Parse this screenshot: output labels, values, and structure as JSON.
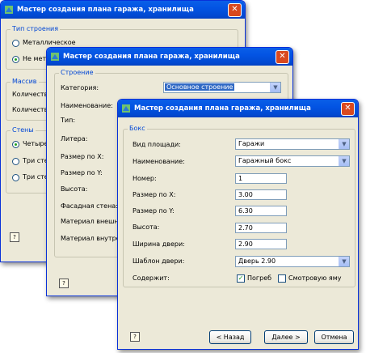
{
  "windows": {
    "w1": {
      "title": "Мастер создания плана гаража, хранилища",
      "close_glyph": "✕",
      "group_type": {
        "label": "Тип строения",
        "options": [
          "Металлическое",
          "Не мет"
        ]
      },
      "group_massiv": {
        "label": "Массив",
        "rows": [
          "Количеств",
          "Количеств"
        ]
      },
      "group_walls": {
        "label": "Стены",
        "options": [
          "Четыре",
          "Три сте",
          "Три сте"
        ]
      },
      "help_glyph": "?"
    },
    "w2": {
      "title": "Мастер создания плана гаража, хранилища",
      "close_glyph": "✕",
      "group_label": "Строение",
      "rows": [
        "Категория:",
        "Наименование:",
        "Тип:",
        "Литера:",
        "Размер по X:",
        "Размер по Y:",
        "Высота:",
        "Фасадная стена:",
        "Материал внешни",
        "Материал внутрен"
      ],
      "category_value": "Основное строение",
      "help_glyph": "?"
    },
    "w3": {
      "title": "Мастер создания плана гаража, хранилища",
      "close_glyph": "✕",
      "group_label": "Бокс",
      "fields": {
        "area_type": {
          "label": "Вид площади:",
          "value": "Гаражи"
        },
        "name": {
          "label": "Наименование:",
          "value": "Гаражный бокс"
        },
        "number": {
          "label": "Номер:",
          "value": "1"
        },
        "size_x": {
          "label": "Размер по X:",
          "value": "3.00"
        },
        "size_y": {
          "label": "Размер по Y:",
          "value": "6.30"
        },
        "height": {
          "label": "Высота:",
          "value": "2.70"
        },
        "door_width": {
          "label": "Ширина двери:",
          "value": "2.90"
        },
        "door_template": {
          "label": "Шаблон двери:",
          "value": "Дверь 2.90"
        }
      },
      "contains": {
        "label": "Содержит:",
        "cellar": "Погреб",
        "cellar_checked": true,
        "pit": "Смотровую яму",
        "pit_checked": false
      },
      "buttons": {
        "back": "< Назад",
        "next": "Далее >",
        "cancel": "Отмена"
      },
      "help_glyph": "?"
    }
  }
}
